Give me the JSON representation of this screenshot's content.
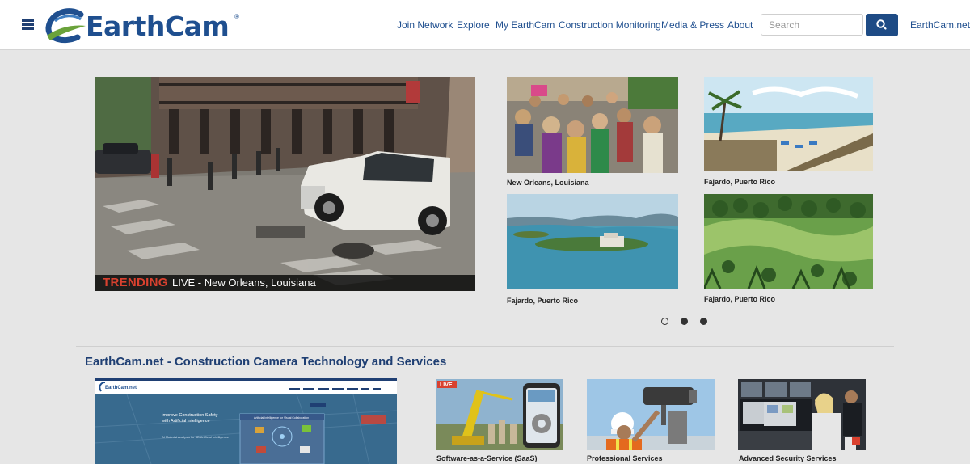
{
  "header": {
    "logo_text": "EarthCam",
    "logo_mark": "®",
    "nav": [
      {
        "label": "Join Network"
      },
      {
        "label": "Explore"
      },
      {
        "label": "My EarthCam"
      },
      {
        "label": "Construction Monitoring"
      },
      {
        "label": "Media & Press"
      },
      {
        "label": "About"
      }
    ],
    "search_placeholder": "Search",
    "network_link": "EarthCam.net"
  },
  "hero": {
    "badge": "TRENDING",
    "caption": "LIVE - New Orleans, Louisiana"
  },
  "thumbnails": [
    {
      "caption": "New Orleans, Louisiana",
      "scene": "crowd"
    },
    {
      "caption": "Fajardo, Puerto Rico",
      "scene": "beach"
    },
    {
      "caption": "Fajardo, Puerto Rico",
      "scene": "island"
    },
    {
      "caption": "Fajardo, Puerto Rico",
      "scene": "golf"
    }
  ],
  "carousel": {
    "slides": 3,
    "active": 1
  },
  "section": {
    "title": "EarthCam.net - Construction Camera Technology and Services",
    "screenshot": {
      "logo": "EarthCam.net",
      "headline_1": "Improve Construction Safety",
      "headline_2": "with Artificial Intelligence",
      "body": "AI Material Analysis for 3D Artificial Intelligence",
      "card_title": "Artificial Intelligence for Visual Collaboration"
    },
    "services": [
      {
        "caption": "Software-as-a-Service (SaaS)",
        "badge": "LIVE"
      },
      {
        "caption": "Professional Services"
      },
      {
        "caption": "Advanced Security Services"
      }
    ]
  },
  "colors": {
    "brand": "#1f4f8f",
    "accent": "#d9412f",
    "button": "#1e4b85"
  }
}
